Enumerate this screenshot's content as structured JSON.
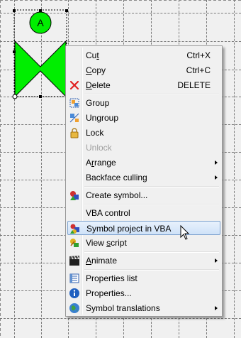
{
  "canvas": {
    "shape_label": "A",
    "shape_fill": "#00ee00"
  },
  "context_menu": {
    "items": [
      {
        "label": "Cut",
        "underline": "t",
        "shortcut": "Ctrl+X",
        "icon": "none"
      },
      {
        "label": "Copy",
        "underline": "C",
        "shortcut": "Ctrl+C",
        "icon": "none"
      },
      {
        "label": "Delete",
        "underline": "D",
        "shortcut": "DELETE",
        "icon": "delete-x-icon"
      },
      {
        "label": "Group",
        "underline": "",
        "icon": "group-icon"
      },
      {
        "label": "Ungroup",
        "underline": "",
        "icon": "ungroup-icon"
      },
      {
        "label": "Lock",
        "underline": "",
        "icon": "lock-icon"
      },
      {
        "label": "Unlock",
        "underline": "",
        "icon": "none",
        "disabled": true
      },
      {
        "label": "Arrange",
        "underline": "r",
        "submenu": true
      },
      {
        "label": "Backface culling",
        "underline": "",
        "submenu": true
      },
      {
        "label": "Create symbol...",
        "underline": "",
        "icon": "symbol-icon"
      },
      {
        "label": "VBA control",
        "underline": "",
        "icon": "none"
      },
      {
        "label": "Symbol project in VBA",
        "underline": "",
        "icon": "vba-project-icon",
        "highlighted": true
      },
      {
        "label": "View script",
        "underline": "s",
        "icon": "script-icon"
      },
      {
        "label": "Animate",
        "underline": "A",
        "icon": "clapperboard-icon",
        "submenu": true
      },
      {
        "label": "Properties list",
        "underline": "",
        "icon": "properties-list-icon"
      },
      {
        "label": "Properties...",
        "underline": "",
        "icon": "info-icon"
      },
      {
        "label": "Symbol translations",
        "underline": "",
        "icon": "globe-icon",
        "submenu": true
      }
    ],
    "highlight_color": "#cfe2f8"
  }
}
